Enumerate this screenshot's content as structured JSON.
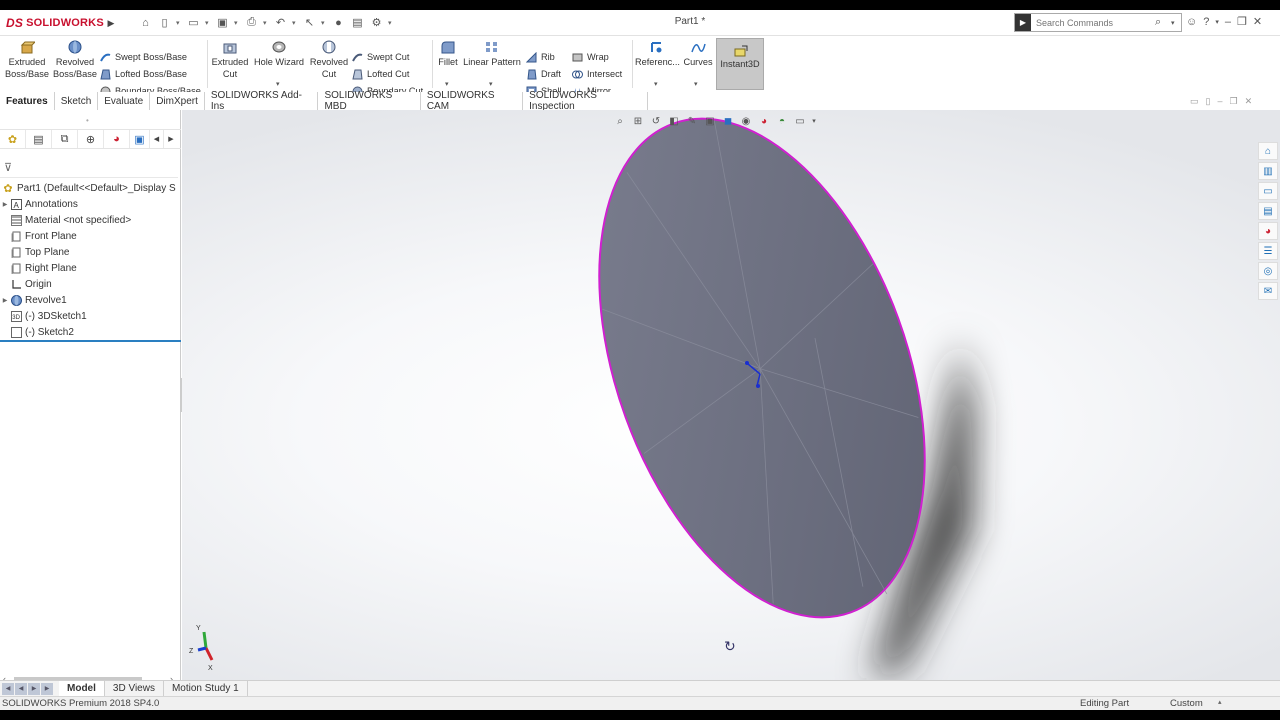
{
  "app": {
    "brand": "SOLIDWORKS",
    "brand_mark": "DS",
    "document_title": "Part1 *"
  },
  "search": {
    "placeholder": "Search Commands"
  },
  "features_toolbar": {
    "extruded_boss": "Extruded Boss/Base",
    "revolved_boss": "Revolved Boss/Base",
    "swept_boss": "Swept Boss/Base",
    "lofted_boss": "Lofted Boss/Base",
    "boundary_boss": "Boundary Boss/Base",
    "extruded_cut": "Extruded Cut",
    "hole_wizard": "Hole Wizard",
    "revolved_cut": "Revolved Cut",
    "swept_cut": "Swept Cut",
    "lofted_cut": "Lofted Cut",
    "boundary_cut": "Boundary Cut",
    "fillet": "Fillet",
    "linear_pattern": "Linear Pattern",
    "rib": "Rib",
    "draft": "Draft",
    "shell": "Shell",
    "wrap": "Wrap",
    "intersect": "Intersect",
    "mirror": "Mirror",
    "reference": "Referenc...",
    "curves": "Curves",
    "instant3d": "Instant3D"
  },
  "tabs": [
    {
      "label": "Features",
      "active": true
    },
    {
      "label": "Sketch"
    },
    {
      "label": "Evaluate"
    },
    {
      "label": "DimXpert"
    },
    {
      "label": "SOLIDWORKS Add-Ins"
    },
    {
      "label": "SOLIDWORKS MBD"
    },
    {
      "label": "SOLIDWORKS CAM"
    },
    {
      "label": "SOLIDWORKS Inspection"
    }
  ],
  "tree": {
    "root": "Part1  (Default<<Default>_Display S",
    "items": [
      {
        "label": "Annotations",
        "icon": "annotations-icon",
        "expandable": true
      },
      {
        "label": "Material <not specified>",
        "icon": "material-icon",
        "expandable": false
      },
      {
        "label": "Front Plane",
        "icon": "plane-icon",
        "expandable": false
      },
      {
        "label": "Top Plane",
        "icon": "plane-icon",
        "expandable": false
      },
      {
        "label": "Right Plane",
        "icon": "plane-icon",
        "expandable": false
      },
      {
        "label": "Origin",
        "icon": "origin-icon",
        "expandable": false
      },
      {
        "label": "Revolve1",
        "icon": "revolve-feature-icon",
        "expandable": true
      },
      {
        "label": "(-) 3DSketch1",
        "icon": "3dsketch-icon",
        "expandable": false
      },
      {
        "label": "(-) Sketch2",
        "icon": "sketch-icon",
        "expandable": false
      }
    ]
  },
  "triad": {
    "x": "X",
    "y": "Y",
    "z": "Z"
  },
  "bottom_tabs": [
    {
      "label": "Model",
      "active": true
    },
    {
      "label": "3D Views"
    },
    {
      "label": "Motion Study 1"
    }
  ],
  "status": {
    "product": "SOLIDWORKS Premium 2018 SP4.0",
    "mode": "Editing Part",
    "units": "Custom"
  },
  "colors": {
    "brand_red": "#c8102e",
    "model_face": "#6f7282",
    "edge_highlight": "#d020d0",
    "tree_separator": "#2a7fc1"
  }
}
